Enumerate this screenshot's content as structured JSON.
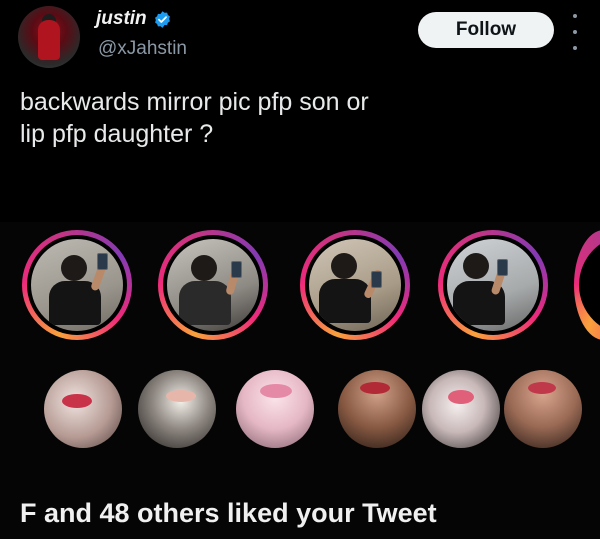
{
  "author": {
    "display_name": "justin",
    "handle": "@xJahstin",
    "verified": true,
    "avatar": "avatar-photo"
  },
  "actions": {
    "follow_label": "Follow",
    "more_icon": "more-options-icon"
  },
  "tweet": {
    "text": "backwards mirror pic pfp son or\nlip pfp daughter ?"
  },
  "media": {
    "stories": [
      {
        "name": "mirror-selfie-pfp-1"
      },
      {
        "name": "mirror-selfie-pfp-2"
      },
      {
        "name": "mirror-selfie-pfp-3"
      },
      {
        "name": "mirror-selfie-pfp-4"
      }
    ],
    "lip_pfps": [
      {
        "name": "lip-pfp-1"
      },
      {
        "name": "lip-pfp-2"
      },
      {
        "name": "lip-pfp-3"
      },
      {
        "name": "lip-pfp-4"
      },
      {
        "name": "lip-pfp-5"
      },
      {
        "name": "lip-pfp-6"
      }
    ],
    "caption": "F and 48 others liked your Tweet"
  },
  "colors": {
    "background": "#000000",
    "verified_badge": "#1d9bf0",
    "follow_button_bg": "#eff3f4",
    "handle_gray": "#8b98a5"
  }
}
